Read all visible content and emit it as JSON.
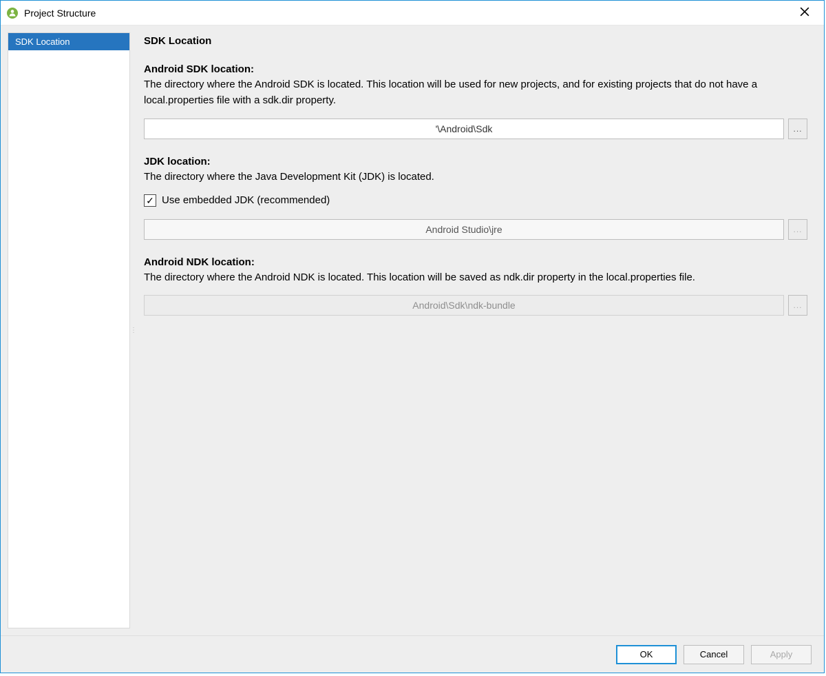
{
  "window": {
    "title": "Project Structure"
  },
  "sidebar": {
    "items": [
      {
        "label": "SDK Location",
        "selected": true
      }
    ]
  },
  "page": {
    "title": "SDK Location",
    "sdk": {
      "header": "Android SDK location:",
      "desc": "The directory where the Android SDK is located. This location will be used for new projects, and for existing projects that do not have a local.properties file with a sdk.dir property.",
      "value": "'\\Android\\Sdk",
      "browse_label": "..."
    },
    "jdk": {
      "header": "JDK location:",
      "desc": "The directory where the Java Development Kit (JDK) is located.",
      "checkbox_label": "Use embedded JDK (recommended)",
      "checkbox_checked": true,
      "value": "Android Studio\\jre",
      "browse_label": "..."
    },
    "ndk": {
      "header": "Android NDK location:",
      "desc": "The directory where the Android NDK is located. This location will be saved as ndk.dir property in the local.properties file.",
      "value": "Android\\Sdk\\ndk-bundle",
      "browse_label": "..."
    }
  },
  "footer": {
    "ok": "OK",
    "cancel": "Cancel",
    "apply": "Apply"
  }
}
